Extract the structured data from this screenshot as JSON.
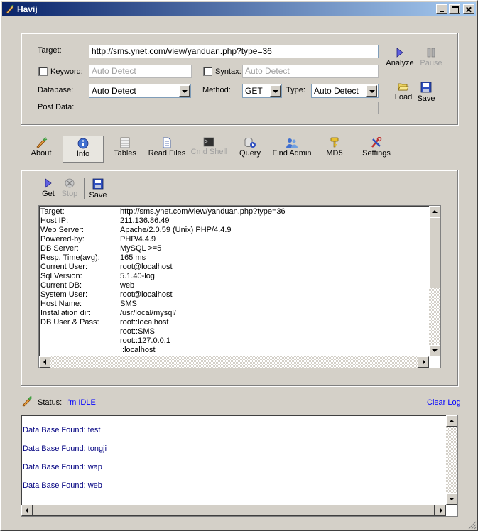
{
  "window": {
    "title": "Havij"
  },
  "form": {
    "target_label": "Target:",
    "target_value": "http://sms.ynet.com/view/yanduan.php?type=36",
    "keyword_label": "Keyword:",
    "keyword_placeholder": "Auto Detect",
    "syntax_label": "Syntax:",
    "syntax_placeholder": "Auto Detect",
    "database_label": "Database:",
    "database_value": "Auto Detect",
    "method_label": "Method:",
    "method_value": "GET",
    "type_label": "Type:",
    "type_value": "Auto Detect",
    "postdata_label": "Post Data:"
  },
  "actions": {
    "analyze": "Analyze",
    "pause": "Pause",
    "load": "Load",
    "save": "Save"
  },
  "tabs": [
    {
      "label": "About"
    },
    {
      "label": "Info"
    },
    {
      "label": "Tables"
    },
    {
      "label": "Read Files"
    },
    {
      "label": "Cmd Shell"
    },
    {
      "label": "Query"
    },
    {
      "label": "Find Admin"
    },
    {
      "label": "MD5"
    },
    {
      "label": "Settings"
    }
  ],
  "info_toolbar": {
    "get": "Get",
    "stop": "Stop",
    "save": "Save"
  },
  "info": [
    {
      "k": "Target:",
      "v": "http://sms.ynet.com/view/yanduan.php?type=36"
    },
    {
      "k": "Host IP:",
      "v": "211.136.86.49"
    },
    {
      "k": "Web Server:",
      "v": "Apache/2.0.59 (Unix) PHP/4.4.9"
    },
    {
      "k": "Powered-by:",
      "v": "PHP/4.4.9"
    },
    {
      "k": "DB Server:",
      "v": "MySQL >=5"
    },
    {
      "k": "Resp. Time(avg):",
      "v": "165 ms"
    },
    {
      "k": "Current User:",
      "v": "root@localhost"
    },
    {
      "k": "Sql Version:",
      "v": "5.1.40-log"
    },
    {
      "k": "Current DB:",
      "v": "web"
    },
    {
      "k": "System User:",
      "v": "root@localhost"
    },
    {
      "k": "Host Name:",
      "v": "SMS"
    },
    {
      "k": "Installation dir:",
      "v": "/usr/local/mysql/"
    },
    {
      "k": "DB User & Pass:",
      "v": "root::localhost"
    },
    {
      "k": "",
      "v": "root::SMS"
    },
    {
      "k": "",
      "v": "root::127.0.0.1"
    },
    {
      "k": "",
      "v": "::localhost"
    }
  ],
  "status": {
    "label": "Status:",
    "value": "I'm IDLE",
    "clear_log": "Clear Log"
  },
  "log": [
    "Data Base Found: test",
    "Data Base Found: tongji",
    "Data Base Found: wap",
    "Data Base Found: web"
  ]
}
